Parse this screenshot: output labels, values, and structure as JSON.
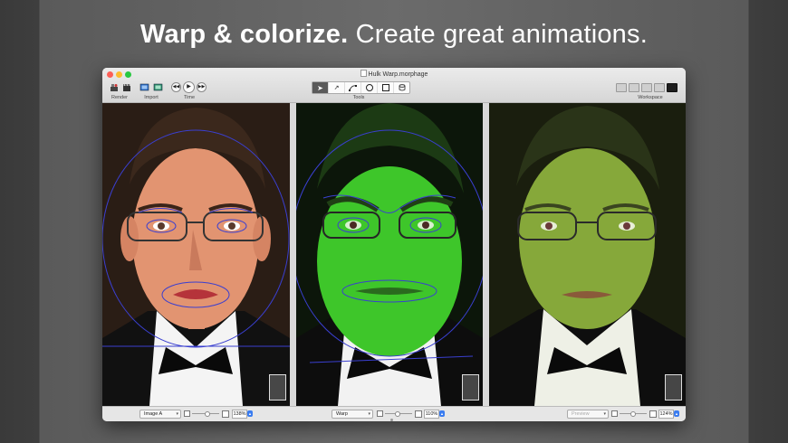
{
  "headline": {
    "bold": "Warp & colorize.",
    "rest": "Create great animations."
  },
  "window": {
    "title": "Hulk Warp.morphage"
  },
  "toolbar": {
    "render_label": "Render",
    "import_label": "Import",
    "time_label": "Time",
    "tools_label": "Tools",
    "workspace_label": "Workspace"
  },
  "icons": {
    "render": "render-icon",
    "movie": "clapperboard-icon",
    "import": "import-icon",
    "rewind": "rewind-icon",
    "play": "play-icon",
    "forward": "forward-icon",
    "select": "arrow-icon",
    "warp": "warp-icon",
    "circle": "circle-icon",
    "square": "square-icon",
    "mask": "mask-icon"
  },
  "colors": {
    "accent": "#3a7cf0",
    "warp_lines": "#3a3fd0",
    "hulk_green": "#3fd02a"
  },
  "panels": [
    {
      "select_value": "Image A",
      "zoom": "138%",
      "select_enabled": true
    },
    {
      "select_value": "Warp",
      "zoom": "110%",
      "select_enabled": true
    },
    {
      "select_value": "Preview",
      "zoom": "124%",
      "select_enabled": false
    }
  ]
}
